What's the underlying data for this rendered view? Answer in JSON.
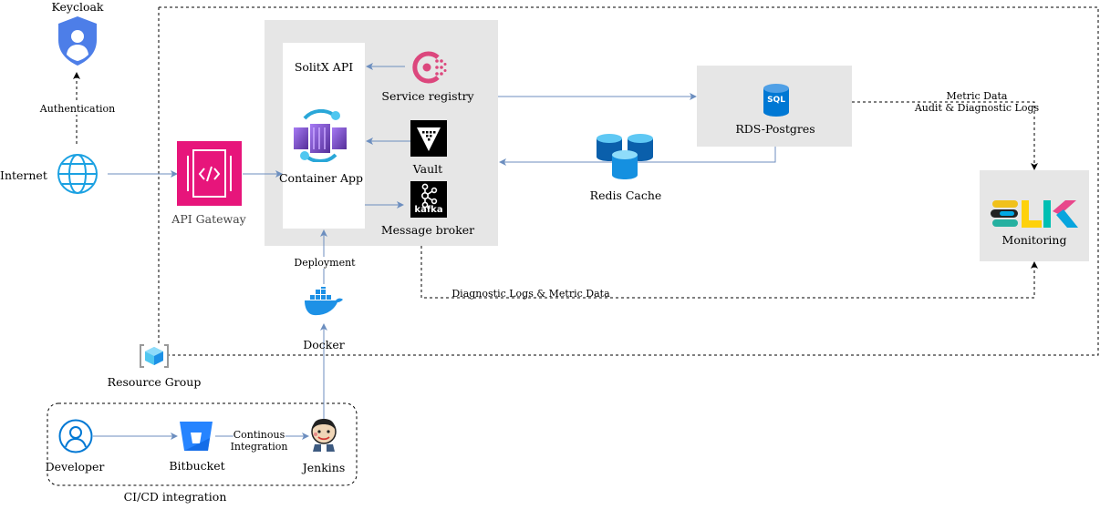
{
  "nodes": {
    "keycloak": "Keycloak",
    "internet": "Internet",
    "api_gateway": "API Gateway",
    "solitx_api": "SolitX API",
    "container_app": "Container App",
    "service_registry": "Service registry",
    "vault": "Vault",
    "message_broker": "Message broker",
    "kafka_logo_text": "kafka",
    "rds_postgres": "RDS-Postgres",
    "sql_badge": "SQL",
    "redis_cache": "Redis Cache",
    "monitoring": "Monitoring",
    "docker": "Docker",
    "resource_group": "Resource Group",
    "developer": "Developer",
    "bitbucket": "Bitbucket",
    "jenkins": "Jenkins",
    "cicd_group": "CI/CD integration"
  },
  "edges": {
    "authentication": "Authentication",
    "deployment": "Deployment",
    "metric_data": "Metric Data",
    "audit_logs": "Audit & Diagnostic Logs",
    "diag_logs": "Diagnostic Logs & Metric Data",
    "continuous_line1": "Continous",
    "continuous_line2": "Integration"
  },
  "colors": {
    "arrow": "#6c8ebf",
    "gateway": "#e7157b",
    "globe": "#1ba1e2",
    "keycloak": "#4d7ee8",
    "azure": "#0078d4",
    "consul": "#dc477d",
    "redis": "#1590e0",
    "panel": "#e6e6e6"
  }
}
